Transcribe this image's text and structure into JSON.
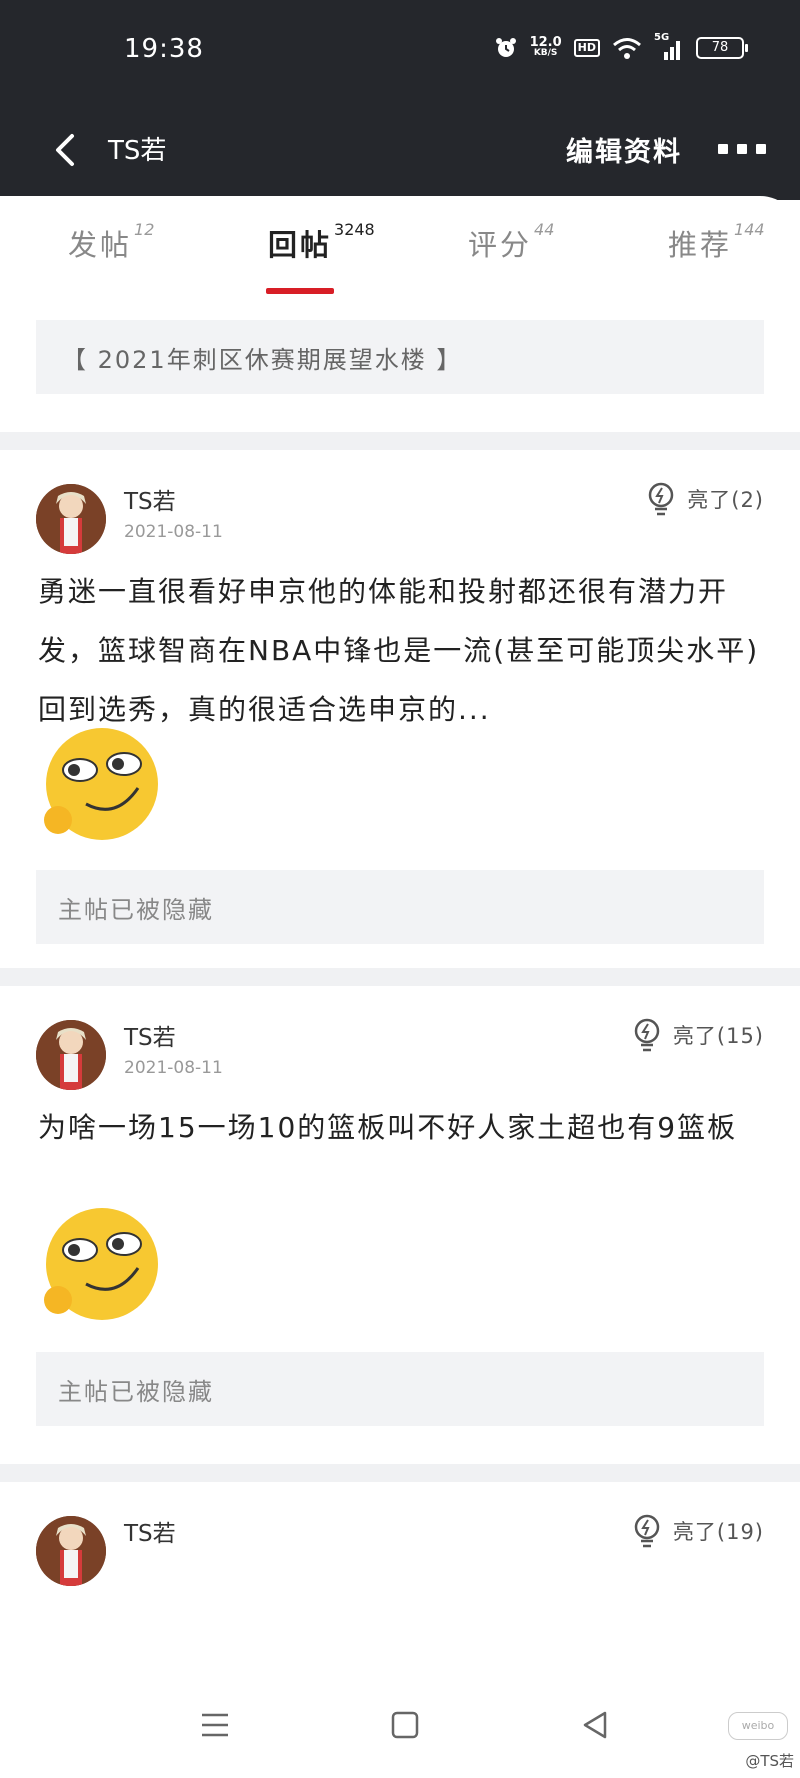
{
  "status_bar": {
    "time": "19:38",
    "net_speed_value": "12.0",
    "net_speed_unit": "KB/S",
    "hd_label": "HD",
    "network_label": "5G",
    "battery": "78"
  },
  "nav": {
    "title": "TS若",
    "edit_label": "编辑资料"
  },
  "tabs": [
    {
      "label": "发帖",
      "count": "12"
    },
    {
      "label": "回帖",
      "count": "3248"
    },
    {
      "label": "评分",
      "count": "44"
    },
    {
      "label": "推荐",
      "count": "144"
    }
  ],
  "active_tab": "回帖",
  "thread_title": "【 2021年刺区休赛期展望水楼 】",
  "posts": [
    {
      "user": "TS若",
      "date": "2021-08-11",
      "light_label": "亮了(2)",
      "body": "勇迷一直很看好申京他的体能和投射都还很有潜力开发，篮球智商在NBA中锋也是一流(甚至可能顶尖水平)回到选秀，真的很适合选申京的...",
      "hidden_note": "主帖已被隐藏"
    },
    {
      "user": "TS若",
      "date": "2021-08-11",
      "light_label": "亮了(15)",
      "body": "为啥一场15一场10的篮板叫不好人家土超也有9篮板",
      "hidden_note": "主帖已被隐藏"
    },
    {
      "user": "TS若",
      "light_label": "亮了(19)"
    }
  ],
  "watermark": "@TS若",
  "watermark_logo": "weibo",
  "colors": {
    "header_bg": "#25272c",
    "accent_red": "#d81e26",
    "box_bg": "#f2f3f5"
  }
}
